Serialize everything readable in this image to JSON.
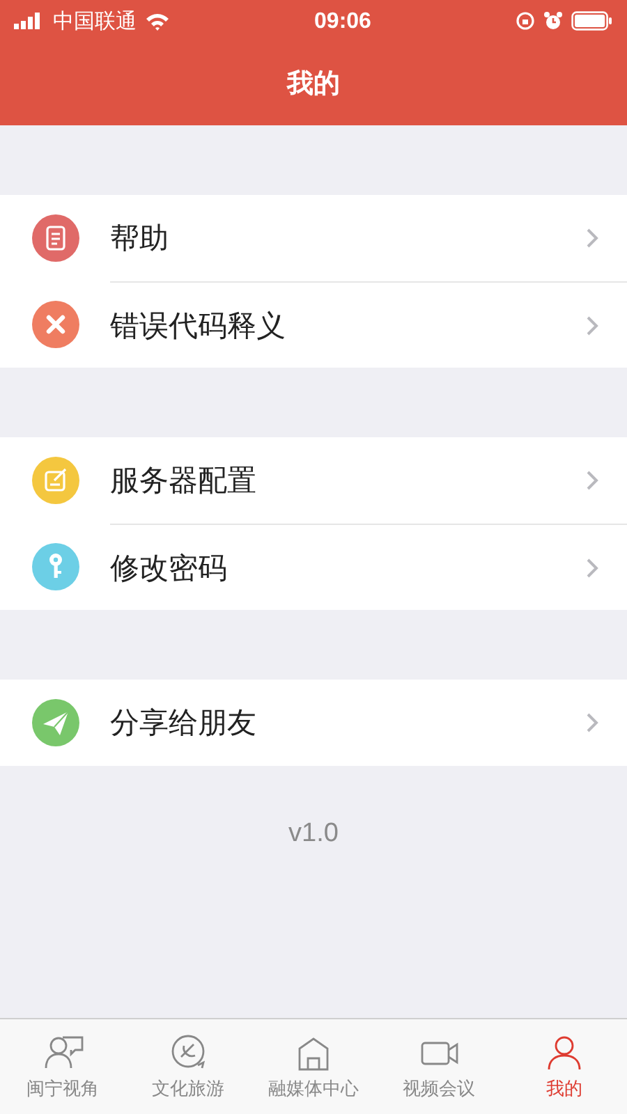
{
  "status_bar": {
    "carrier": "中国联通",
    "time": "09:06"
  },
  "header": {
    "title": "我的"
  },
  "menu_groups": [
    {
      "items": [
        {
          "label": "帮助",
          "kind": "document",
          "color": "#e06a68"
        },
        {
          "label": "错误代码释义",
          "kind": "cross",
          "color": "#ef7d61"
        }
      ]
    },
    {
      "items": [
        {
          "label": "服务器配置",
          "kind": "edit",
          "color": "#f4c73f"
        },
        {
          "label": "修改密码",
          "kind": "key",
          "color": "#6ccfe6"
        }
      ]
    },
    {
      "items": [
        {
          "label": "分享给朋友",
          "kind": "plane",
          "color": "#79c76b"
        }
      ]
    }
  ],
  "version": "v1.0",
  "tab_bar": [
    {
      "label": "闽宁视角",
      "kind": "people",
      "selected": false
    },
    {
      "label": "文化旅游",
      "kind": "emblem",
      "selected": false
    },
    {
      "label": "融媒体中心",
      "kind": "building",
      "selected": false
    },
    {
      "label": "视频会议",
      "kind": "video",
      "selected": false
    },
    {
      "label": "我的",
      "kind": "person",
      "selected": true
    }
  ]
}
